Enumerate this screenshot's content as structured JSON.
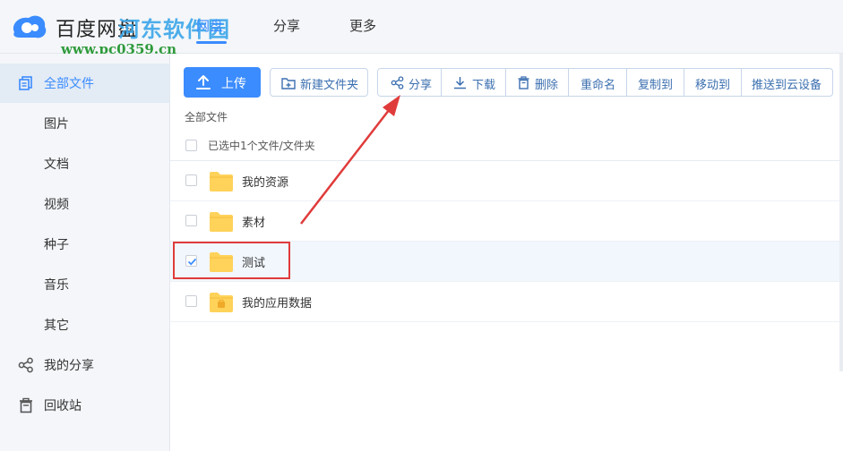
{
  "app": {
    "title": "百度网盘",
    "watermark_name": "河东软件园",
    "watermark_url": "www.pc0359.cn"
  },
  "nav": {
    "tabs": [
      {
        "label": "网盘",
        "active": true
      },
      {
        "label": "分享",
        "active": false
      },
      {
        "label": "更多",
        "active": false
      }
    ]
  },
  "sidebar": {
    "items": [
      {
        "label": "全部文件",
        "icon": "files-icon",
        "active": true
      },
      {
        "label": "图片"
      },
      {
        "label": "文档"
      },
      {
        "label": "视频"
      },
      {
        "label": "种子"
      },
      {
        "label": "音乐"
      },
      {
        "label": "其它"
      },
      {
        "label": "我的分享",
        "icon": "share-icon"
      },
      {
        "label": "回收站",
        "icon": "trash-icon"
      }
    ]
  },
  "toolbar": {
    "upload_label": "上传",
    "new_folder_label": "新建文件夹",
    "actions": [
      {
        "label": "分享",
        "icon": "share-icon"
      },
      {
        "label": "下载",
        "icon": "download-icon"
      },
      {
        "label": "删除",
        "icon": "trash-icon"
      },
      {
        "label": "重命名"
      },
      {
        "label": "复制到"
      },
      {
        "label": "移动到"
      },
      {
        "label": "推送到云设备"
      }
    ]
  },
  "breadcrumb": "全部文件",
  "selection_info": "已选中1个文件/文件夹",
  "files": [
    {
      "name": "我的资源",
      "checked": false
    },
    {
      "name": "素材",
      "checked": false
    },
    {
      "name": "测试",
      "checked": true
    },
    {
      "name": "我的应用数据",
      "checked": false
    }
  ],
  "colors": {
    "accent": "#3b8cff",
    "annotation": "#e03b3b",
    "folder": "#ffd25a"
  }
}
